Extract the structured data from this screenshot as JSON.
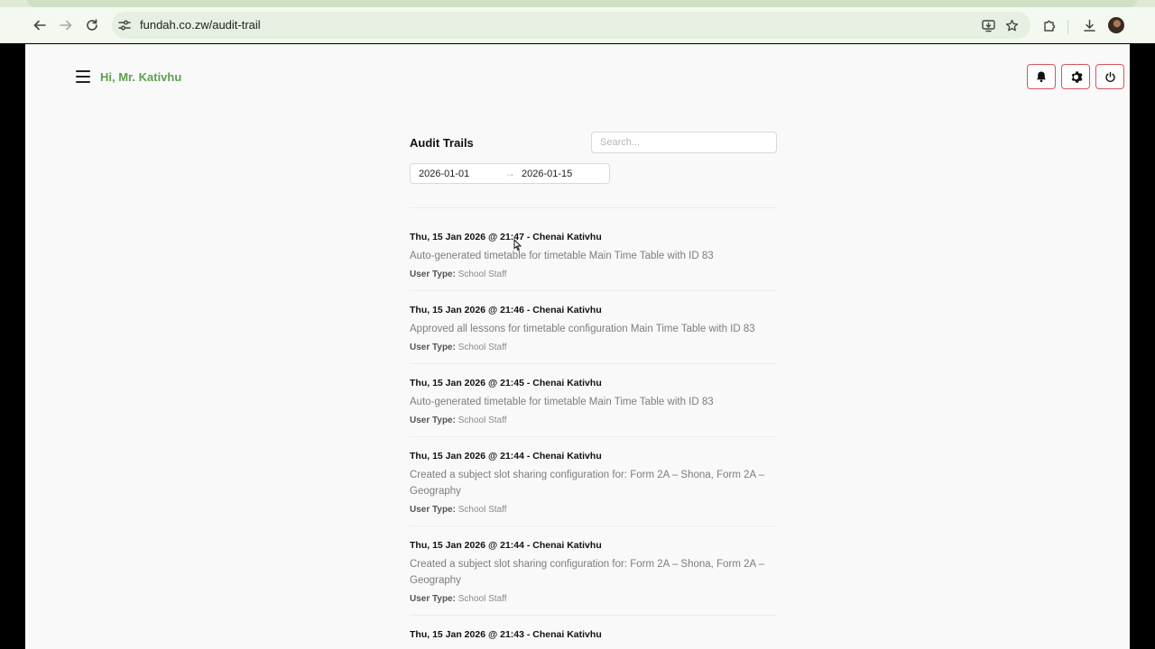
{
  "browser": {
    "url": "fundah.co.zw/audit-trail"
  },
  "header": {
    "greeting": "Hi, Mr. Kativhu"
  },
  "audit": {
    "title": "Audit Trails",
    "search_placeholder": "Search...",
    "date_from": "2026-01-01",
    "date_to": "2026-01-15",
    "date_separator": "→",
    "entries": [
      {
        "heading": "Thu, 15 Jan 2026 @ 21:47 - Chenai Kativhu",
        "description": "Auto-generated timetable for timetable Main Time Table with ID 83",
        "user_type_label": "User Type:",
        "user_type": "School Staff"
      },
      {
        "heading": "Thu, 15 Jan 2026 @ 21:46 - Chenai Kativhu",
        "description": "Approved all lessons for timetable configuration Main Time Table with ID 83",
        "user_type_label": "User Type:",
        "user_type": "School Staff"
      },
      {
        "heading": "Thu, 15 Jan 2026 @ 21:45 - Chenai Kativhu",
        "description": "Auto-generated timetable for timetable Main Time Table with ID 83",
        "user_type_label": "User Type:",
        "user_type": "School Staff"
      },
      {
        "heading": "Thu, 15 Jan 2026 @ 21:44 - Chenai Kativhu",
        "description": "Created a subject slot sharing configuration for: Form 2A – Shona, Form 2A – Geography",
        "user_type_label": "User Type:",
        "user_type": "School Staff"
      },
      {
        "heading": "Thu, 15 Jan 2026 @ 21:44 - Chenai Kativhu",
        "description": "Created a subject slot sharing configuration for: Form 2A – Shona, Form 2A – Geography",
        "user_type_label": "User Type:",
        "user_type": "School Staff"
      },
      {
        "heading": "Thu, 15 Jan 2026 @ 21:43 - Chenai Kativhu",
        "description": "",
        "user_type_label": "",
        "user_type": ""
      }
    ]
  },
  "colors": {
    "accent_green": "#5fa04e",
    "button_border_red": "#d9545c"
  },
  "icons": {
    "back": "back-arrow-icon",
    "forward": "forward-arrow-icon",
    "reload": "reload-icon",
    "site_settings": "tune-icon",
    "install": "install-app-icon",
    "bookmark": "star-icon",
    "extensions": "puzzle-icon",
    "downloads": "download-icon",
    "menu": "hamburger-icon",
    "notifications": "bell-icon",
    "settings": "gear-icon",
    "logout": "power-icon"
  }
}
